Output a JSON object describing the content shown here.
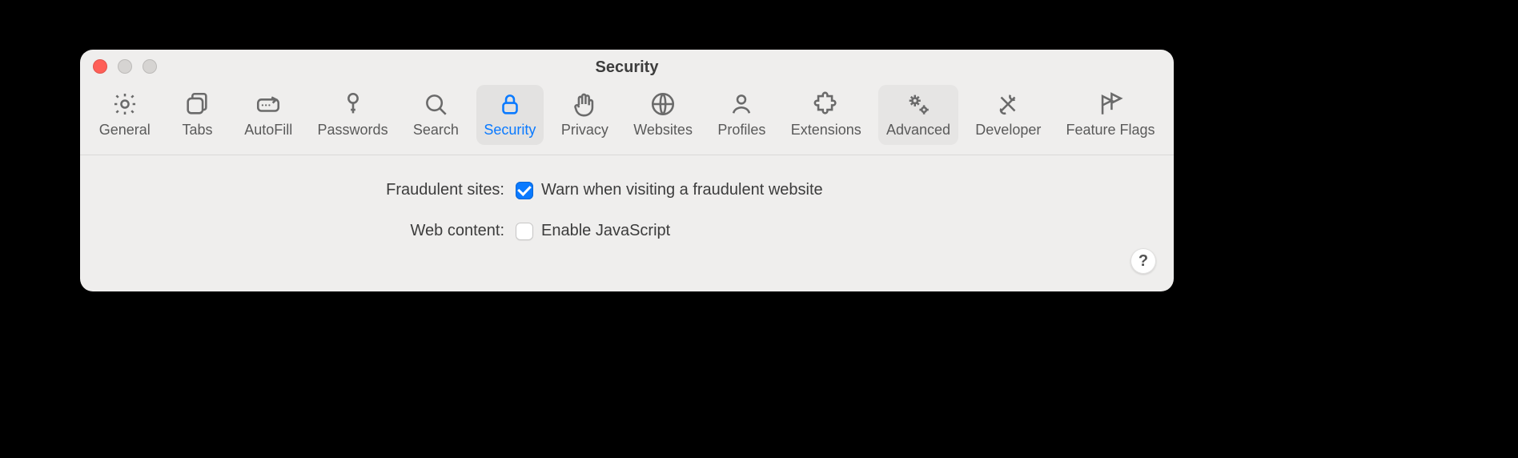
{
  "window": {
    "title": "Security"
  },
  "toolbar": {
    "items": [
      {
        "id": "general",
        "label": "General",
        "icon": "gear-icon"
      },
      {
        "id": "tabs",
        "label": "Tabs",
        "icon": "tabs-icon"
      },
      {
        "id": "autofill",
        "label": "AutoFill",
        "icon": "pencil-box-icon"
      },
      {
        "id": "passwords",
        "label": "Passwords",
        "icon": "key-icon"
      },
      {
        "id": "search",
        "label": "Search",
        "icon": "search-icon"
      },
      {
        "id": "security",
        "label": "Security",
        "icon": "lock-icon"
      },
      {
        "id": "privacy",
        "label": "Privacy",
        "icon": "hand-icon"
      },
      {
        "id": "websites",
        "label": "Websites",
        "icon": "globe-icon"
      },
      {
        "id": "profiles",
        "label": "Profiles",
        "icon": "person-icon"
      },
      {
        "id": "extensions",
        "label": "Extensions",
        "icon": "puzzle-icon"
      },
      {
        "id": "advanced",
        "label": "Advanced",
        "icon": "gears-icon"
      },
      {
        "id": "developer",
        "label": "Developer",
        "icon": "tools-icon"
      },
      {
        "id": "featureflags",
        "label": "Feature Flags",
        "icon": "flags-icon"
      }
    ],
    "selected_id": "security",
    "highlighted_id": "advanced"
  },
  "content": {
    "rows": [
      {
        "label": "Fraudulent sites:",
        "checkbox_label": "Warn when visiting a fraudulent website",
        "checked": true
      },
      {
        "label": "Web content:",
        "checkbox_label": "Enable JavaScript",
        "checked": false
      }
    ]
  },
  "help_button": {
    "glyph": "?"
  },
  "traffic_lights": {
    "close_active": true,
    "minimize_active": false,
    "zoom_active": false
  }
}
